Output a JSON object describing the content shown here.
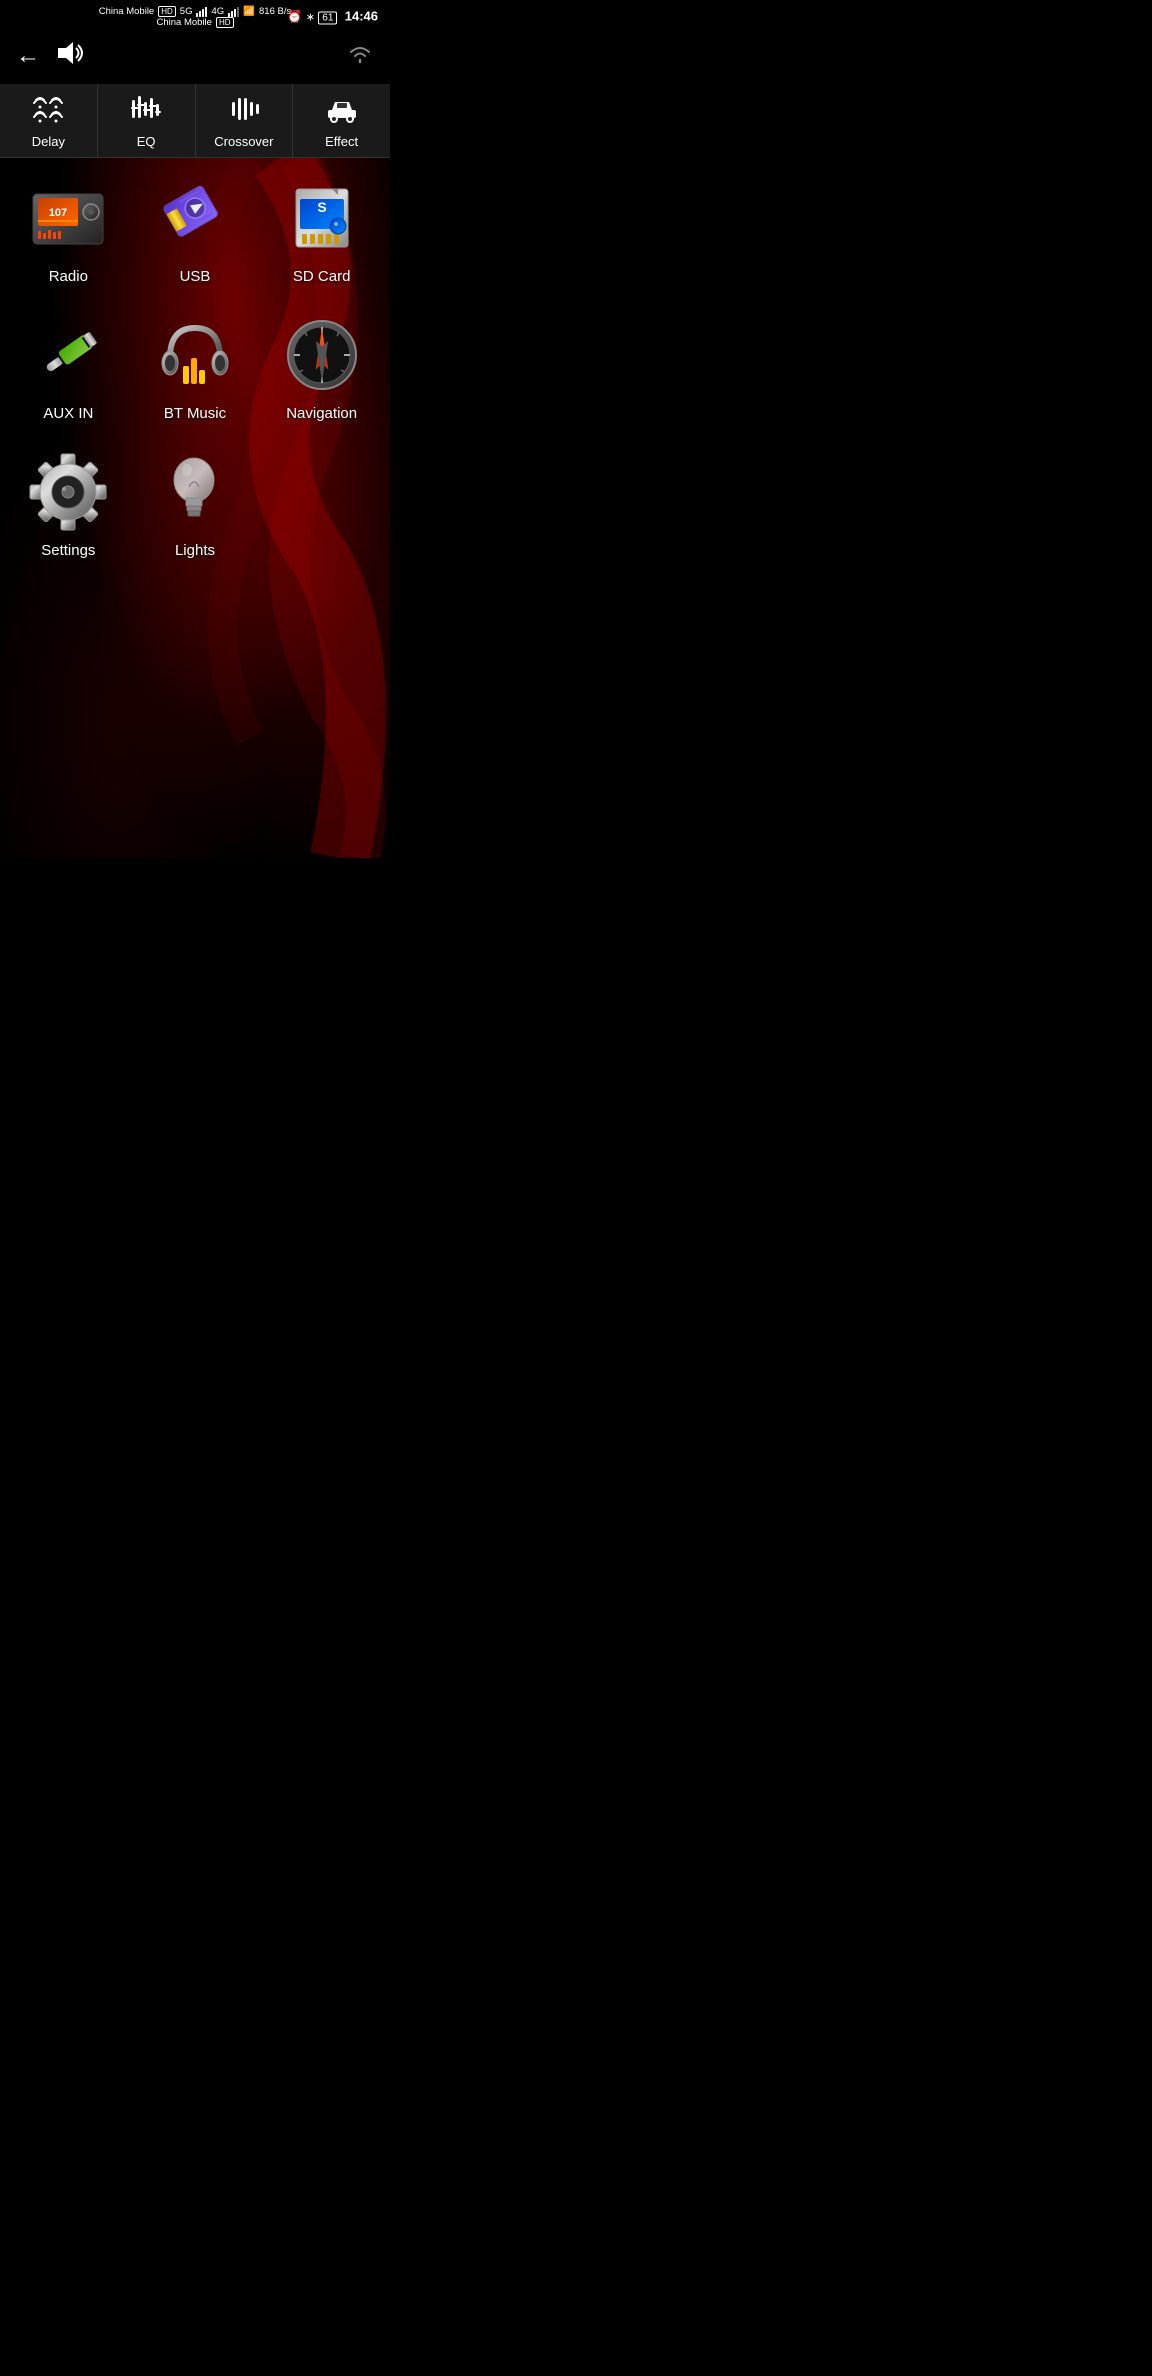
{
  "statusBar": {
    "carrier1": "China Mobile",
    "carrier2": "China Mobile",
    "hd_badge": "HD",
    "network1": "5G",
    "network2": "4G",
    "data_speed": "816 B/s",
    "time": "14:46"
  },
  "topBar": {
    "back_label": "←",
    "volume_label": "🔊"
  },
  "tabs": [
    {
      "id": "delay",
      "label": "Delay",
      "icon": "delay"
    },
    {
      "id": "eq",
      "label": "EQ",
      "icon": "eq"
    },
    {
      "id": "crossover",
      "label": "Crossover",
      "icon": "crossover"
    },
    {
      "id": "effect",
      "label": "Effect",
      "icon": "effect"
    }
  ],
  "apps": [
    {
      "id": "radio",
      "label": "Radio"
    },
    {
      "id": "usb",
      "label": "USB"
    },
    {
      "id": "sdcard",
      "label": "SD Card"
    },
    {
      "id": "auxin",
      "label": "AUX IN"
    },
    {
      "id": "btmusic",
      "label": "BT Music"
    },
    {
      "id": "navigation",
      "label": "Navigation"
    },
    {
      "id": "settings",
      "label": "Settings"
    },
    {
      "id": "lights",
      "label": "Lights"
    }
  ]
}
